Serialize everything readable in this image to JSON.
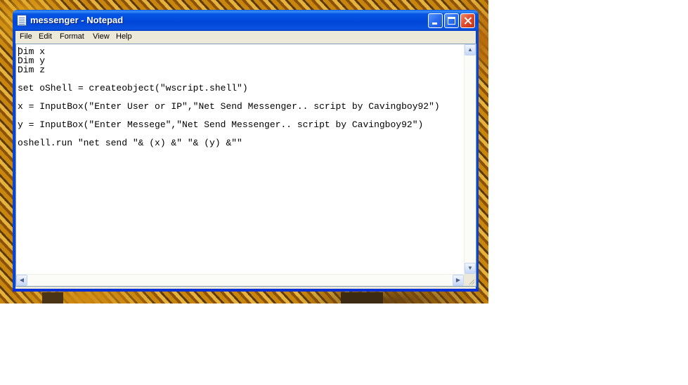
{
  "window": {
    "title": "messenger - Notepad",
    "app_icon": "notepad-icon",
    "controls": {
      "minimize_icon": "minimize-icon",
      "maximize_icon": "maximize-icon",
      "close_icon": "close-icon"
    }
  },
  "menu": {
    "items": [
      {
        "label": "File"
      },
      {
        "label": "Edit"
      },
      {
        "label": "Format"
      },
      {
        "label": "View"
      },
      {
        "label": "Help"
      }
    ]
  },
  "editor": {
    "lines": [
      "Dim x",
      "Dim y",
      "Dim z",
      "set oShell = createobject(\"wscript.shell\")",
      "x = InputBox(\"Enter User or IP\",\"Net Send Messenger.. script by Cavingboy92\")",
      "y = InputBox(\"Enter Messege\",\"Net Send Messenger.. script by Cavingboy92\")",
      "oshell.run \"net send \"& (x) &\" \"& (y) &\"\""
    ]
  },
  "scrollbars": {
    "up_arrow": "▲",
    "down_arrow": "▼",
    "left_arrow": "◀",
    "right_arrow": "▶"
  },
  "colors": {
    "titlebar": "#0054e3",
    "window_frame": "#ece9d8",
    "editor_bg": "#ffffff",
    "desktop": "#a86a10"
  }
}
